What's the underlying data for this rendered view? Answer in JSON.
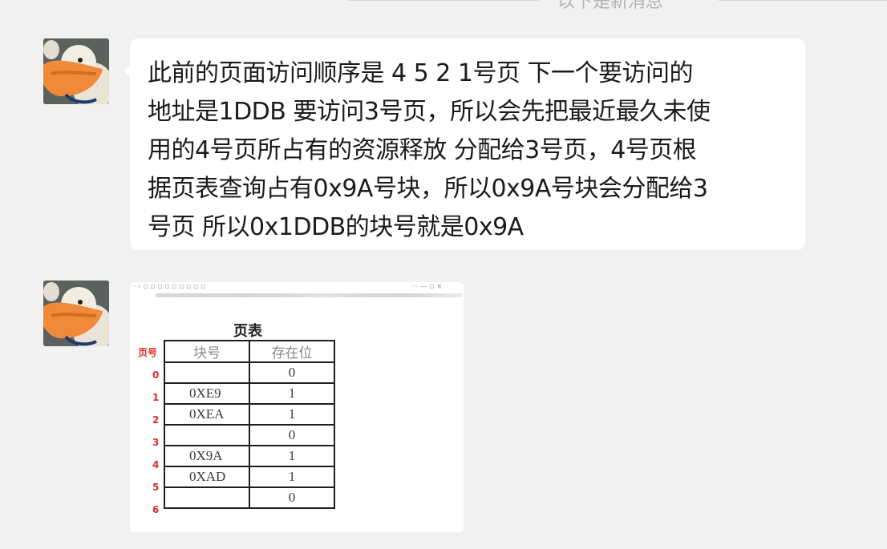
{
  "divider": {
    "label": "以下是新消息"
  },
  "messages": [
    {
      "type": "text",
      "lines": [
        " 此前的页面访问顺序是 4 5 2 1号页 下一个要访问的",
        "地址是1DDB 要访问3号页，所以会先把最近最久未使",
        "用的4号页所占有的资源释放 分配给3号页，4号页根",
        "据页表查询占有0x9A号块，所以0x9A号块会分配给3",
        "号页 所以0x1DDB的块号就是0x9A"
      ]
    },
    {
      "type": "image",
      "table_title": "页表",
      "page_no_header": "页号",
      "headers": [
        "块号",
        "存在位"
      ],
      "rows": [
        {
          "page": "0",
          "block": "",
          "present": "0"
        },
        {
          "page": "1",
          "block": "0XE9",
          "present": "1"
        },
        {
          "page": "2",
          "block": "0XEA",
          "present": "1"
        },
        {
          "page": "3",
          "block": "",
          "present": "0"
        },
        {
          "page": "4",
          "block": "0X9A",
          "present": "1"
        },
        {
          "page": "5",
          "block": "0XAD",
          "present": "1"
        },
        {
          "page": "6",
          "block": "",
          "present": "0"
        }
      ]
    }
  ],
  "avatar": {
    "icon": "cartoon-dog-avatar"
  },
  "colors": {
    "background": "#f1f1f1",
    "bubble": "#ffffff",
    "page_number_red": "#e12b2b",
    "text": "#1b1b1b"
  }
}
